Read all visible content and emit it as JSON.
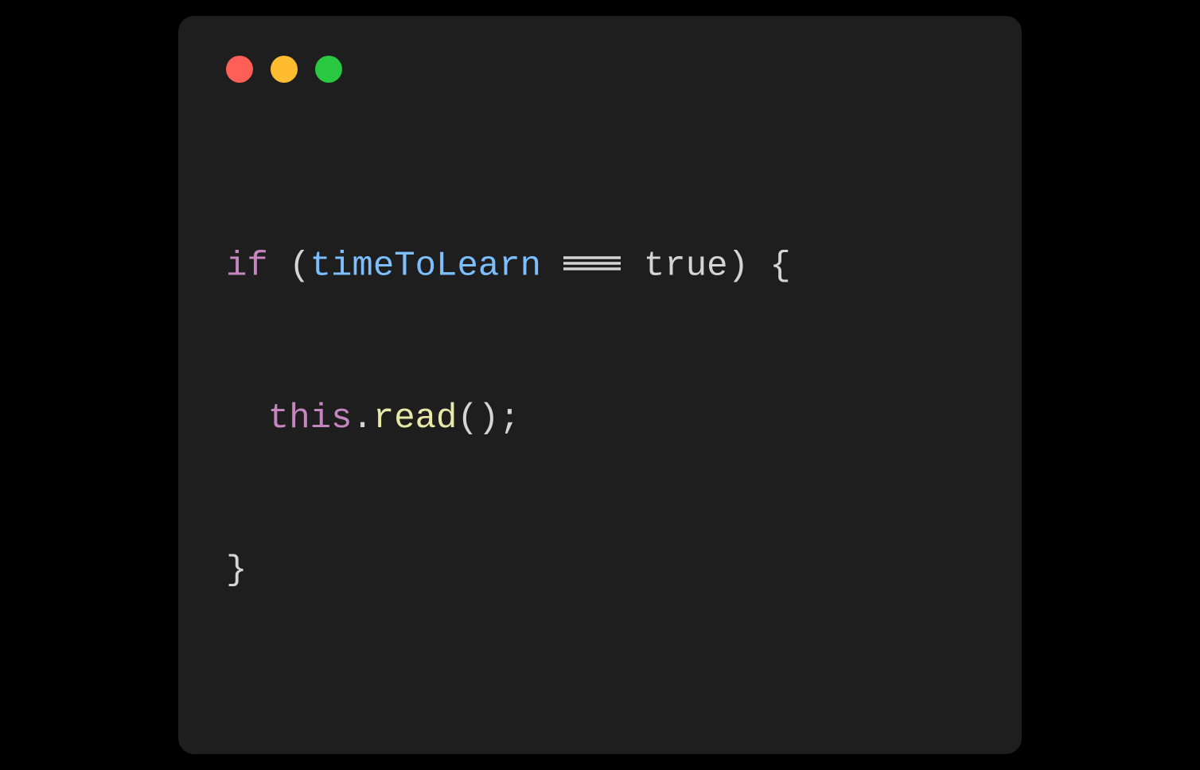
{
  "window": {
    "traffic_lights": {
      "close_color": "#ff5f57",
      "minimize_color": "#febc2e",
      "maximize_color": "#28c840"
    }
  },
  "code": {
    "line1": {
      "keyword_if": "if",
      "paren_open": " (",
      "variable": "timeToLearn",
      "space1": " ",
      "operator": "===",
      "space2": " ",
      "boolean": "true",
      "paren_close_brace": ") {"
    },
    "line2": {
      "this": "this",
      "dot": ".",
      "method": "read",
      "call": "();"
    },
    "line3": {
      "brace_close": "}"
    }
  },
  "colors": {
    "background": "#000000",
    "window_bg": "#1e1e1e",
    "keyword": "#c586c0",
    "variable": "#7dbeff",
    "punct": "#d4d4d4",
    "method": "#e8e8a8"
  }
}
